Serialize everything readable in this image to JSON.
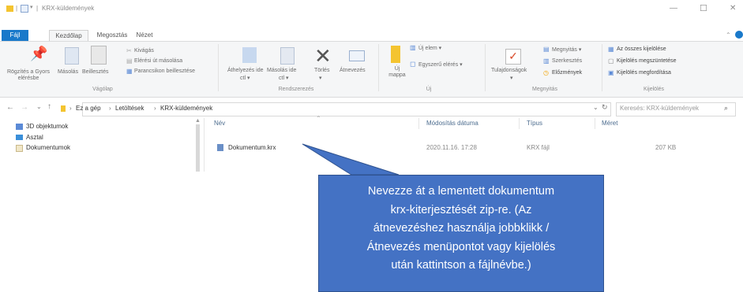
{
  "window": {
    "title": "KRX-küldemények",
    "minimize": "—",
    "maximize": "☐",
    "close": "✕"
  },
  "ribbon_tabs": [
    "Fájl",
    "Kezdőlap",
    "Megosztás",
    "Nézet"
  ],
  "ribbon": {
    "clipboard": {
      "pin_label": "Rögzítés a Gyors elérésbe",
      "copy_label": "Másolás",
      "paste_label": "Beillesztés",
      "cut_label": "Kivágás",
      "copy_path_label": "Elérési út másolása",
      "paste_shortcut_label": "Parancsikon beillesztése",
      "group_label": "Vágólap"
    },
    "organize": {
      "move_label": "Áthelyezés ide",
      "copy_to_label": "Másolás ide",
      "delete_label": "Törlés",
      "rename_label": "Átnevezés",
      "group_label": "Rendszerezés"
    },
    "new": {
      "new_folder_label": "Új mappa",
      "new_item_label": "Új elem",
      "easy_access_label": "Egyszerű elérés",
      "group_label": "Új"
    },
    "open": {
      "properties_label": "Tulajdonságok",
      "open_label": "Megnyitás",
      "edit_label": "Szerkesztés",
      "history_label": "Előzmények",
      "group_label": "Megnyitás"
    },
    "select": {
      "select_all_label": "Az összes kijelölése",
      "select_none_label": "Kijelölés megszüntetése",
      "invert_label": "Kijelölés megfordítása",
      "group_label": "Kijelölés"
    }
  },
  "address": {
    "crumbs": [
      "Ez a gép",
      "Letöltések",
      "KRX-küldemények"
    ],
    "search_placeholder": "Keresés: KRX-küldemények"
  },
  "nav_pane": [
    "3D objektumok",
    "Asztal",
    "Dokumentumok"
  ],
  "file_list": {
    "headers": {
      "name": "Név",
      "modified": "Módosítás dátuma",
      "type": "Típus",
      "size": "Méret"
    },
    "rows": [
      {
        "name": "Dokumentum.krx",
        "modified": "2020.11.16. 17:28",
        "type": "KRX fájl",
        "size": "207 KB"
      }
    ]
  },
  "callout": {
    "lines": [
      "Nevezze át a lementett dokumentum",
      "krx-kiterjesztését zip-re. (Az",
      "átnevezéshez használja jobbklikk /",
      "Átnevezés menüpontot vagy kijelölés",
      "után kattintson a fájlnévbe.)"
    ]
  },
  "colors": {
    "accent": "#1979ca",
    "callout_bg": "#4472c4",
    "callout_border": "#2f528f",
    "folder": "#f4c430"
  }
}
